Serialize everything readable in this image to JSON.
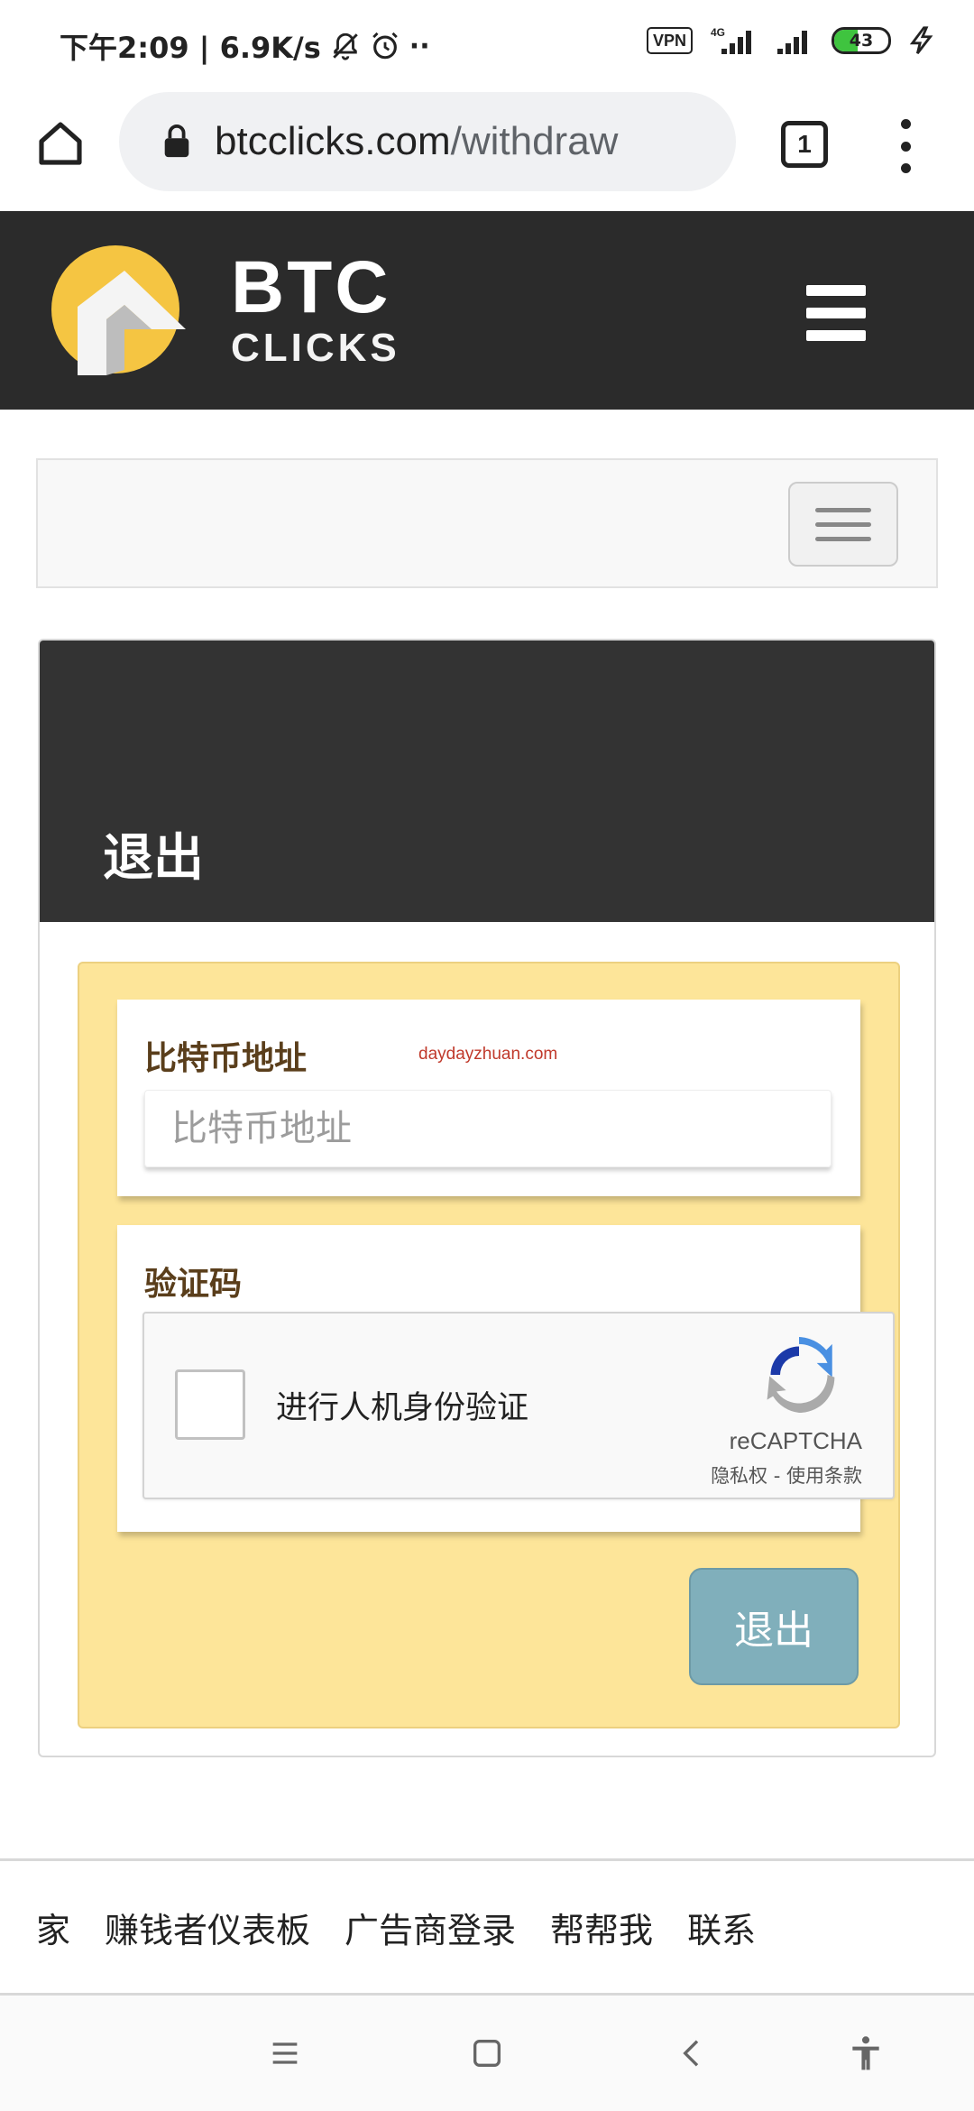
{
  "status_bar": {
    "time_and_speed": "下午2:09 | 6.9K/s",
    "vpn": "VPN",
    "network": "4G",
    "battery": "43",
    "battery_level": 0.43
  },
  "browser": {
    "url_domain": "btcclicks.com",
    "url_path": "/withdraw",
    "tab_count": "1",
    "icons": [
      "home-icon",
      "lock-icon",
      "tabs-icon",
      "more-vert-icon"
    ]
  },
  "site_header": {
    "logo_line1": "BTC",
    "logo_line2": "CLICKS",
    "brand_color": "#f5c542"
  },
  "panel": {
    "title": "退出",
    "address_label": "比特币地址",
    "address_placeholder": "比特币地址",
    "address_value": "",
    "watermark": "daydayzhuan.com",
    "captcha_label": "验证码",
    "recaptcha_text": "进行人机身份验证",
    "recaptcha_brand": "reCAPTCHA",
    "recaptcha_links": "隐私权 - 使用条款",
    "submit_label": "退出"
  },
  "footer": {
    "links": [
      "家",
      "赚钱者仪表板",
      "广告商登录",
      "帮帮我",
      "联系"
    ]
  },
  "colors": {
    "header_bg": "#2b2b2b",
    "panel_head_bg": "#333333",
    "form_bg": "#fde599",
    "submit_bg": "#80afbb",
    "label_color": "#5a3e1b"
  }
}
